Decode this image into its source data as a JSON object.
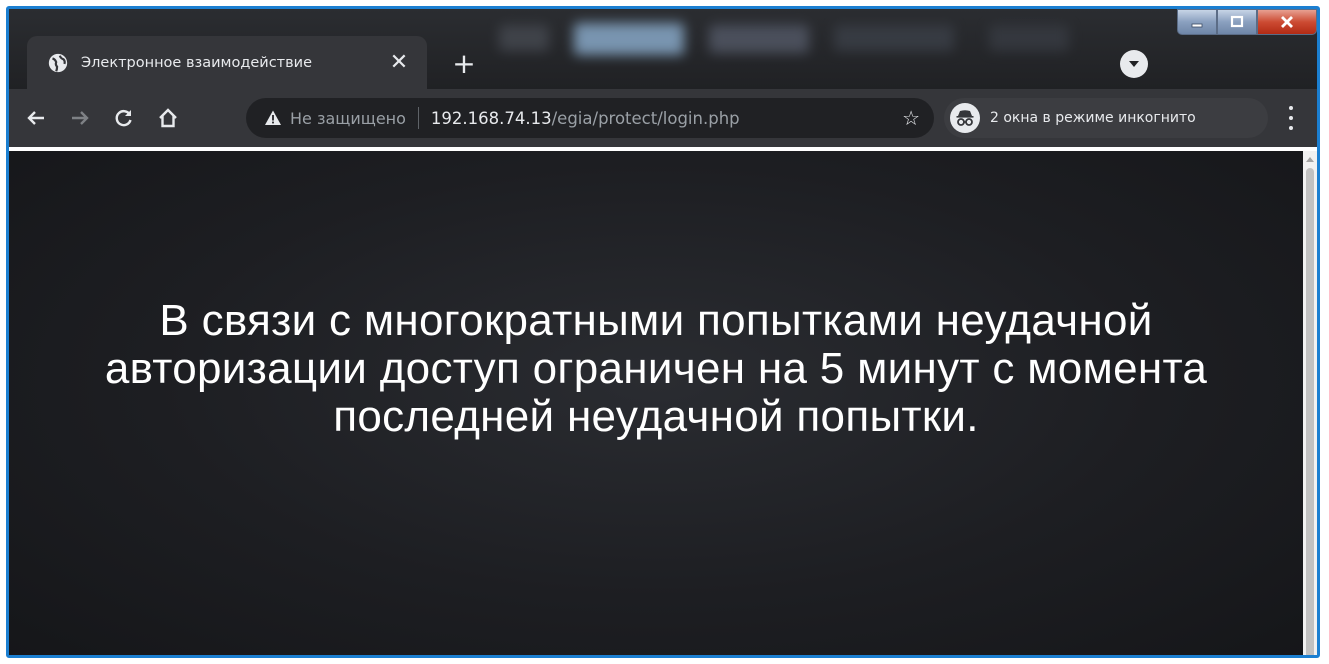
{
  "browser": {
    "tab": {
      "title": "Электронное взаимодействие",
      "close_label": "✕"
    },
    "new_tab_label": "+",
    "window_controls": {
      "minimize_label": "—",
      "maximize_label": "☐",
      "close_label": "✕"
    },
    "toolbar": {
      "back_label": "←",
      "forward_label": "→",
      "reload_label": "C",
      "home_label": "⌂"
    },
    "omnibox": {
      "security_text": "Не защищено",
      "url_host": "192.168.74.13",
      "url_path": "/egia/protect/login.php",
      "bookmark_label": "☆"
    },
    "incognito": {
      "label": "2 окна в режиме инкогнито"
    },
    "colors": {
      "frame_border": "#1b7fd1",
      "toolbar_bg": "#35363a",
      "tabstrip_bg": "#202124",
      "page_bg": "#1d1e22",
      "message_text": "#ffffff"
    }
  },
  "page": {
    "message": "В связи с многократными попытками неудачной авторизации доступ ограничен на 5 минут с момента последней неудачной попытки."
  }
}
